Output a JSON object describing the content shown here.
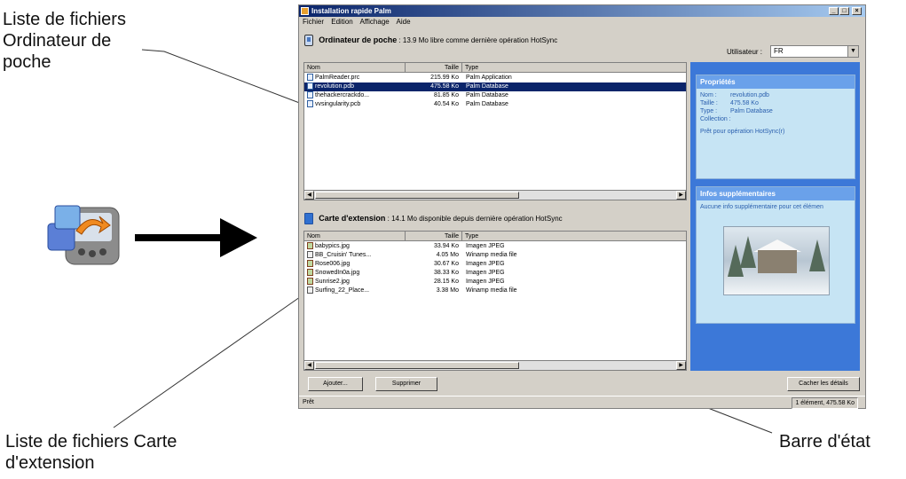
{
  "callouts": {
    "device_list_line1": "Liste de fichiers",
    "device_list_line2": "Ordinateur de",
    "device_list_line3": "poche",
    "card_list_line1": "Liste de fichiers Carte",
    "card_list_line2": "d'extension",
    "status_bar": "Barre d'état"
  },
  "window": {
    "title": "Installation rapide Palm",
    "menu": [
      "Fichier",
      "Edition",
      "Affichage",
      "Aide"
    ]
  },
  "device": {
    "name": "Ordinateur de poche",
    "info": " : 13.9 Mo libre comme dernière opération HotSync",
    "user_label": "Utilisateur :",
    "user_value": "FR",
    "columns": [
      "Nom",
      "Taille",
      "Type"
    ],
    "files": [
      {
        "name": "PalmReader.prc",
        "size": "215.99 Ko",
        "type": "Palm Application"
      },
      {
        "name": "revolution.pdb",
        "size": "475.58 Ko",
        "type": "Palm Database"
      },
      {
        "name": "thehackercrackdo...",
        "size": "81.85 Ko",
        "type": "Palm Database"
      },
      {
        "name": "vvsingularity.pcb",
        "size": "40.54 Ko",
        "type": "Palm Database"
      }
    ],
    "selected_index": 1
  },
  "card": {
    "name": "Carte d'extension",
    "info": " : 14.1 Mo disponible depuis dernière opération HotSync",
    "columns": [
      "Nom",
      "Taille",
      "Type"
    ],
    "files": [
      {
        "name": "babypics.jpg",
        "size": "33.94 Ko",
        "type": "Imagen JPEG",
        "icon": "image"
      },
      {
        "name": "BB_Cruisin' Tunes...",
        "size": "4.05 Mo",
        "type": "Winamp media file",
        "icon": "audio"
      },
      {
        "name": "Rose006.jpg",
        "size": "30.67 Ko",
        "type": "Imagen JPEG",
        "icon": "image"
      },
      {
        "name": "SnowedIn0a.jpg",
        "size": "38.33 Ko",
        "type": "Imagen JPEG",
        "icon": "image"
      },
      {
        "name": "Sunrise2.jpg",
        "size": "28.15 Ko",
        "type": "Imagen JPEG",
        "icon": "image"
      },
      {
        "name": "Surfing_22_Place...",
        "size": "3.38 Mo",
        "type": "Winamp media file",
        "icon": "audio"
      }
    ]
  },
  "buttons": {
    "add": "Ajouter...",
    "delete": "Supprimer",
    "hide_details": "Cacher les détails"
  },
  "properties": {
    "title": "Propriétés",
    "name_label": "Nom :",
    "name_value": "revolution.pdb",
    "size_label": "Taille :",
    "size_value": "475.58 Ko",
    "type_label": "Type :",
    "type_value": "Palm Database",
    "collection_label": "Collection :",
    "ready": "Prêt pour opération HotSync(r)"
  },
  "extra_info": {
    "title": "Infos supplémentaires",
    "text": "Aucune info supplémentaire pour cet élémen"
  },
  "status": {
    "left": "Prêt",
    "right": "1 élément, 475.58 Ko"
  },
  "colors": {
    "selection": "#0a246a",
    "panel": "#3c78d8",
    "card": "#c6e4f4"
  }
}
